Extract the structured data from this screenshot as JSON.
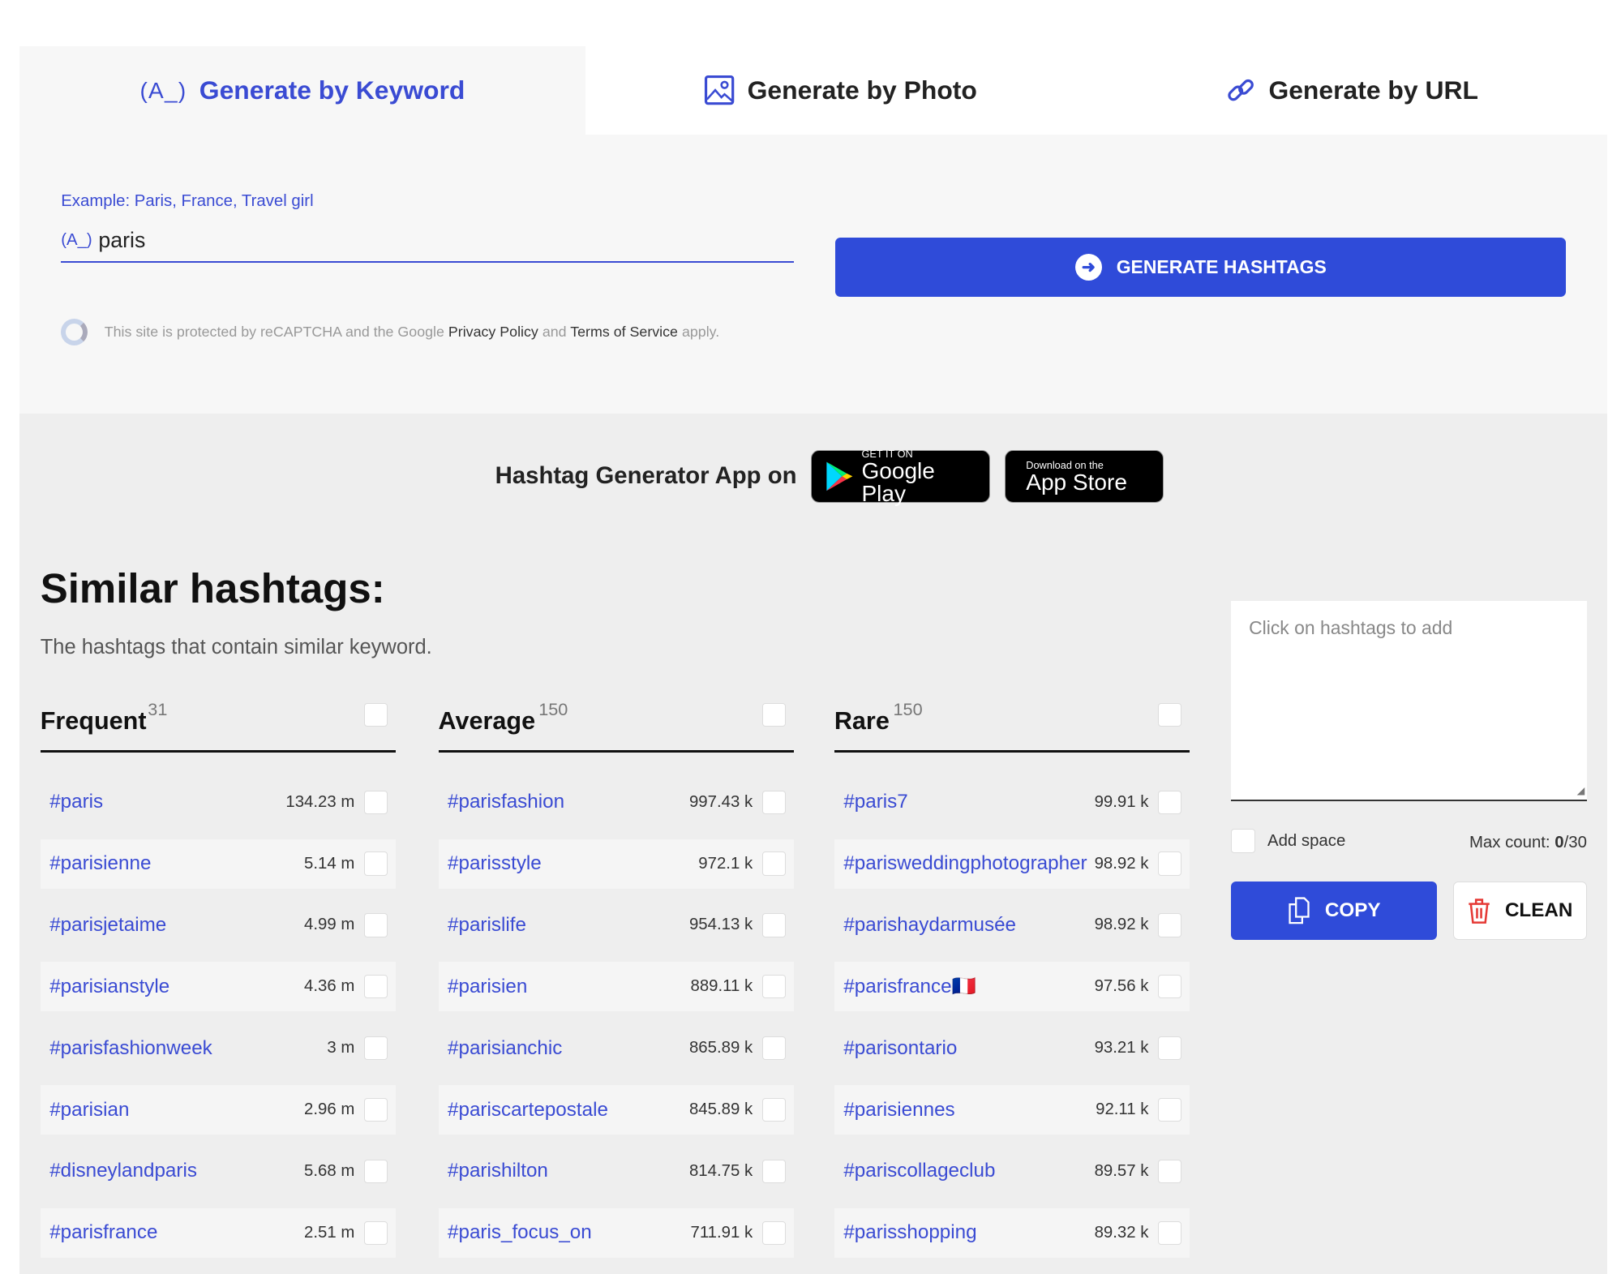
{
  "tabs": [
    {
      "label": "Generate by Keyword",
      "icon": "keyword-icon",
      "icon_text": "(A_)",
      "active": true
    },
    {
      "label": "Generate by Photo",
      "icon": "image-icon"
    },
    {
      "label": "Generate by URL",
      "icon": "link-icon"
    }
  ],
  "form": {
    "label": "Example: Paris, France, Travel girl",
    "icon_text": "(A_)",
    "value": "paris",
    "button": "GENERATE HASHTAGS",
    "recaptcha": {
      "pre": "This site is protected by reCAPTCHA and the Google",
      "privacy": "Privacy Policy",
      "and": "and",
      "terms": "Terms of Service",
      "post": "apply."
    }
  },
  "app": {
    "text": "Hashtag Generator App on",
    "google": {
      "small": "GET IT ON",
      "big": "Google Play"
    },
    "apple": {
      "small": "Download on the",
      "big": "App Store"
    }
  },
  "similar": {
    "title": "Similar hashtags:",
    "subtitle": "The hashtags that contain similar keyword."
  },
  "columns": [
    {
      "title": "Frequent",
      "count": "31",
      "rows": [
        [
          "#paris",
          "134.23 m"
        ],
        [
          "#parisienne",
          "5.14 m"
        ],
        [
          "#parisjetaime",
          "4.99 m"
        ],
        [
          "#parisianstyle",
          "4.36 m"
        ],
        [
          "#parisfashionweek",
          "3 m"
        ],
        [
          "#parisian",
          "2.96 m"
        ],
        [
          "#disneylandparis",
          "5.68 m"
        ],
        [
          "#parisfrance",
          "2.51 m"
        ]
      ]
    },
    {
      "title": "Average",
      "count": "150",
      "rows": [
        [
          "#parisfashion",
          "997.43 k"
        ],
        [
          "#parisstyle",
          "972.1 k"
        ],
        [
          "#parislife",
          "954.13 k"
        ],
        [
          "#parisien",
          "889.11 k"
        ],
        [
          "#parisianchic",
          "865.89 k"
        ],
        [
          "#pariscartepostale",
          "845.89 k"
        ],
        [
          "#parishilton",
          "814.75 k"
        ],
        [
          "#paris_focus_on",
          "711.91 k"
        ]
      ]
    },
    {
      "title": "Rare",
      "count": "150",
      "rows": [
        [
          "#paris7",
          "99.91 k"
        ],
        [
          "#parisweddingphotographer",
          "98.92 k"
        ],
        [
          "#parishaydarmusée",
          "98.92 k"
        ],
        [
          "#parisfrance🇫🇷",
          "97.56 k"
        ],
        [
          "#parisontario",
          "93.21 k"
        ],
        [
          "#parisiennes",
          "92.11 k"
        ],
        [
          "#pariscollageclub",
          "89.57 k"
        ],
        [
          "#parisshopping",
          "89.32 k"
        ]
      ]
    }
  ],
  "panel": {
    "placeholder": "Click on hashtags to add",
    "add_space": "Add space",
    "max_label": "Max count:",
    "max_current": "0",
    "max_total": "/30",
    "copy": "COPY",
    "clean": "CLEAN"
  },
  "colors": {
    "accent": "#2f4bd9",
    "link": "#3a4bd3",
    "danger": "#e53935"
  }
}
